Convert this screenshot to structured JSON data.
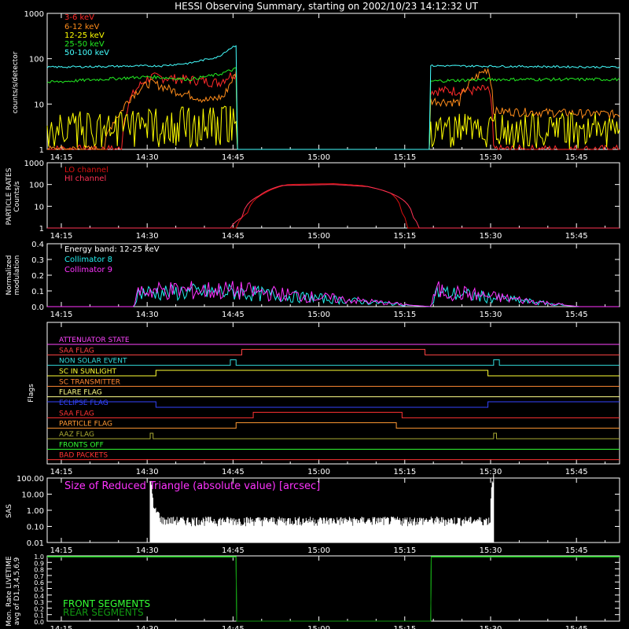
{
  "title": "HESSI Observing Summary, starting on 2002/10/23 14:12:32 UT",
  "time_ticks": [
    "14:15",
    "14:30",
    "14:45",
    "15:00",
    "15:15",
    "15:30",
    "15:45"
  ],
  "time_tick_minutes": [
    2.47,
    17.47,
    32.47,
    47.47,
    62.47,
    77.47,
    92.47
  ],
  "time_range_minutes": [
    0,
    100
  ],
  "colors": {
    "background": "#000000",
    "axes": "#ffffff",
    "band_3_6": "#ff2a2a",
    "band_6_12": "#ff8c1a",
    "band_12_25": "#ffff00",
    "band_25_50": "#22ee22",
    "band_50_100": "#44ffff",
    "lo_channel": "#dd1111",
    "hi_channel": "#ff3355",
    "collimator_8": "#22eeee",
    "collimator_9": "#ff33ff",
    "sas": "#ffffff",
    "front_segments": "#33ff33",
    "rear_segments": "#119911"
  },
  "panels": {
    "counts": {
      "ylabel": "counts/s/detector",
      "yticks": [
        "1000",
        "100",
        "10",
        "1"
      ],
      "legend": [
        "3-6 keV",
        "6-12 keV",
        "12-25 keV",
        "25-50 keV",
        "50-100 keV"
      ]
    },
    "particle": {
      "ylabel_1": "PARTICLE RATES",
      "ylabel_2": "Counts/s",
      "yticks": [
        "1000",
        "100",
        "10",
        "1"
      ],
      "legend": [
        "LO channel",
        "HI channel"
      ]
    },
    "modulation": {
      "ylabel_1": "Normalized",
      "ylabel_2": "modulation",
      "yticks": [
        "0.4",
        "0.3",
        "0.2",
        "0.1",
        "0.0"
      ],
      "legend": [
        "Energy band: 12-25 keV",
        "Collimator 8",
        "Collimator 9"
      ]
    },
    "flags": {
      "ylabel": "Flags",
      "items": [
        {
          "label": "ATTENUATOR STATE",
          "color": "#ff44ff"
        },
        {
          "label": "SAA FLAG",
          "color": "#ff4444"
        },
        {
          "label": "NON SOLAR EVENT",
          "color": "#33dddd"
        },
        {
          "label": "SC IN SUNLIGHT",
          "color": "#ffff33"
        },
        {
          "label": "SC TRANSMITTER",
          "color": "#ff8833"
        },
        {
          "label": "FLARE FLAG",
          "color": "#ffff88"
        },
        {
          "label": "ECLIPSE FLAG",
          "color": "#3344ff"
        },
        {
          "label": "SAA FLAG",
          "color": "#ff3333"
        },
        {
          "label": "PARTICLE FLAG",
          "color": "#ff9933"
        },
        {
          "label": "AAZ FLAG",
          "color": "#aaaa33"
        },
        {
          "label": "FRONTS OFF",
          "color": "#33ff33"
        },
        {
          "label": "BAD PACKETS",
          "color": "#ff3333"
        }
      ]
    },
    "sas": {
      "ylabel": "SAS",
      "yticks": [
        "100.00",
        "10.00",
        "1.00",
        "0.10",
        "0.01"
      ],
      "legend": "Size of Reduced Triangle (absolute value) [arcsec]"
    },
    "livetime": {
      "ylabel_1": "Mon. Rate LIVETIME",
      "ylabel_2": "avg of D1,3,4,5,6,9",
      "yticks": [
        "1.0",
        "0.9",
        "0.8",
        "0.7",
        "0.6",
        "0.5",
        "0.4",
        "0.3",
        "0.2",
        "0.1",
        "0.0"
      ],
      "legend": [
        "FRONT SEGMENTS",
        "REAR SEGMENTS"
      ]
    }
  },
  "chart_data": [
    {
      "type": "line",
      "title": "HESSI Observing Summary, starting on 2002/10/23 14:12:32 UT",
      "xlabel": "",
      "ylabel": "counts/s/detector",
      "yscale": "log",
      "ylim": [
        1,
        1000
      ],
      "x_units": "minutes after 14:12:32 UT",
      "gap": [
        33,
        67
      ],
      "series": [
        {
          "name": "3-6 keV",
          "x": [
            0,
            12.5,
            13,
            18,
            25,
            30,
            33,
            67,
            75,
            77,
            78,
            80,
            100
          ],
          "y": [
            1,
            1,
            0.9,
            40,
            35,
            30,
            50,
            20,
            20,
            22,
            1,
            1,
            1
          ]
        },
        {
          "name": "6-12 keV",
          "x": [
            0,
            10,
            12.5,
            13,
            18,
            22,
            28,
            31,
            33,
            67,
            72,
            77,
            78,
            100
          ],
          "y": [
            1,
            1,
            6,
            7,
            30,
            20,
            12,
            15,
            45,
            12,
            11,
            60,
            7,
            6
          ]
        },
        {
          "name": "12-25 keV",
          "x": [
            0,
            33,
            67,
            100
          ],
          "y": [
            4,
            6,
            4,
            4
          ]
        },
        {
          "name": "25-50 keV",
          "x": [
            0,
            18,
            25,
            30,
            33,
            67,
            77,
            100
          ],
          "y": [
            30,
            40,
            35,
            45,
            60,
            32,
            35,
            35
          ]
        },
        {
          "name": "50-100 keV",
          "x": [
            0,
            20,
            25,
            30,
            33,
            67,
            100
          ],
          "y": [
            65,
            70,
            80,
            110,
            200,
            70,
            65
          ]
        }
      ]
    },
    {
      "type": "line",
      "ylabel": "PARTICLE RATES Counts/s",
      "yscale": "log",
      "ylim": [
        1,
        1000
      ],
      "series": [
        {
          "name": "LO channel",
          "x": [
            0,
            33,
            35,
            38,
            42,
            50,
            55,
            60,
            62,
            63,
            100
          ],
          "y": [
            1,
            1,
            5,
            40,
            100,
            110,
            90,
            40,
            5,
            1,
            1
          ]
        },
        {
          "name": "HI channel",
          "x": [
            0,
            32,
            34,
            37,
            41,
            50,
            56,
            61,
            64,
            65,
            100
          ],
          "y": [
            1,
            1,
            3,
            30,
            90,
            100,
            80,
            30,
            3,
            1,
            1
          ]
        }
      ]
    },
    {
      "type": "line",
      "ylabel": "Normalized modulation",
      "ylim": [
        0,
        0.4
      ],
      "series": [
        {
          "name": "Collimator 8",
          "x": [
            0,
            15,
            16,
            33,
            67,
            68,
            93,
            100
          ],
          "y": [
            0,
            0,
            0.08,
            0.08,
            0,
            0.08,
            0,
            0
          ]
        },
        {
          "name": "Collimator 9",
          "x": [
            0,
            15,
            16,
            33,
            67,
            68,
            93,
            100
          ],
          "y": [
            0,
            0,
            0.09,
            0.09,
            0,
            0.09,
            0,
            0
          ]
        }
      ]
    },
    {
      "type": "line",
      "ylabel": "Flags",
      "series": [
        {
          "name": "ATTENUATOR STATE",
          "x": [
            0,
            100
          ],
          "y": [
            0,
            0
          ]
        },
        {
          "name": "SAA FLAG",
          "x": [
            0,
            34,
            66,
            100
          ],
          "y": [
            0,
            1,
            0,
            0
          ]
        },
        {
          "name": "NON SOLAR EVENT",
          "x": [
            0,
            32,
            33,
            78,
            79,
            100
          ],
          "y": [
            0,
            1,
            0,
            1,
            0,
            0
          ]
        },
        {
          "name": "SC IN SUNLIGHT",
          "x": [
            0,
            19,
            77,
            100
          ],
          "y": [
            0,
            1,
            0,
            0
          ]
        },
        {
          "name": "SC TRANSMITTER",
          "x": [
            0,
            100
          ],
          "y": [
            0,
            0
          ]
        },
        {
          "name": "FLARE FLAG",
          "x": [
            0,
            100
          ],
          "y": [
            0,
            0
          ]
        },
        {
          "name": "ECLIPSE FLAG",
          "x": [
            0,
            19,
            77,
            100
          ],
          "y": [
            1,
            0,
            1,
            1
          ]
        },
        {
          "name": "SAA FLAG",
          "x": [
            0,
            36,
            62,
            100
          ],
          "y": [
            0,
            1,
            0,
            0
          ]
        },
        {
          "name": "PARTICLE FLAG",
          "x": [
            0,
            33,
            61,
            100
          ],
          "y": [
            0,
            1,
            0,
            0
          ]
        },
        {
          "name": "AAZ FLAG",
          "x": [
            0,
            18,
            18.5,
            78,
            78.5,
            100
          ],
          "y": [
            0,
            1,
            0,
            1,
            0,
            0
          ]
        },
        {
          "name": "FRONTS OFF",
          "x": [
            0,
            100
          ],
          "y": [
            0,
            0
          ]
        },
        {
          "name": "BAD PACKETS",
          "x": [
            0,
            100
          ],
          "y": [
            0,
            0
          ]
        }
      ]
    },
    {
      "type": "line",
      "ylabel": "SAS",
      "yscale": "log",
      "ylim": [
        0.01,
        100
      ],
      "series": [
        {
          "name": "Size of Reduced Triangle (absolute value) [arcsec]",
          "x": [
            18,
            18.5,
            20,
            77.5,
            78
          ],
          "y": [
            60,
            1,
            0.2,
            0.2,
            100
          ]
        }
      ]
    },
    {
      "type": "line",
      "ylabel": "Mon. Rate LIVETIME avg of D1,3,4,5,6,9",
      "ylim": [
        0,
        1
      ],
      "series": [
        {
          "name": "FRONT SEGMENTS",
          "x": [
            0,
            33,
            33.1,
            67,
            67.1,
            100
          ],
          "y": [
            0.99,
            0.99,
            0,
            0,
            0.99,
            0.99
          ]
        },
        {
          "name": "REAR SEGMENTS",
          "x": [
            0,
            33,
            33.1,
            67,
            67.1,
            100
          ],
          "y": [
            0.98,
            0.98,
            0,
            0,
            0.98,
            0.98
          ]
        }
      ]
    }
  ]
}
